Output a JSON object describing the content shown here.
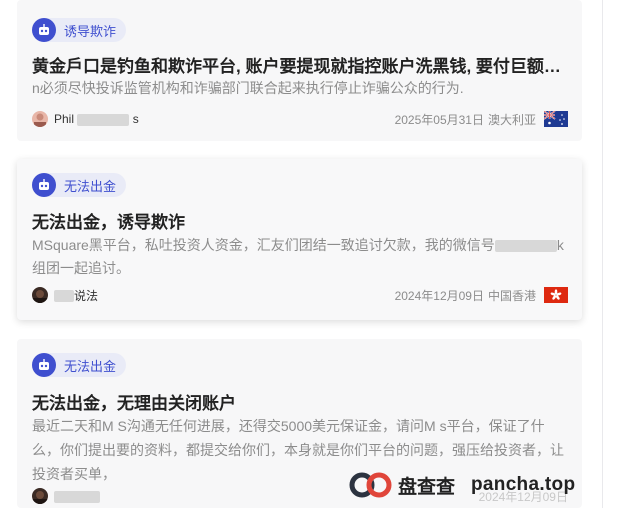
{
  "cards": [
    {
      "tag": "诱导欺诈",
      "title": "黄金戶口是钓鱼和欺诈平台, 账户要提现就指控账户洗黑钱, 要付巨额罰款.…",
      "desc": "n必须尽快投诉监管机构和诈骗部门联合起来执行停止诈骗公众的行为.",
      "user": "Phil",
      "user_tail": "s",
      "date": "2025年05月31日",
      "location": "澳大利亚",
      "flag": "australia-flag-icon"
    },
    {
      "tag": "无法出金",
      "title": "无法出金，诱导欺诈",
      "desc_a": "MSquare黑平台，私吐投资人资金，汇友们团结一致追讨欠款，我的微信号",
      "desc_b": "k",
      "desc_c": "组团一起追讨。",
      "user_tail": "说法",
      "date": "2024年12月09日",
      "location": "中国香港",
      "flag": "hongkong-flag-icon"
    },
    {
      "tag": "无法出金",
      "title": "无法出金，无理由关闭账户",
      "desc": "最近二天和M S沟通无任何进展，还得交5000美元保证金，请问M s平台，保证了什么，你们提出要的资料，都提交给你们，本身就是你们平台的问题，强压给投资者，让投资者买单，",
      "date": "2024年12月09日"
    }
  ],
  "watermark": {
    "brand": "盘查查",
    "domain": "pancha.top"
  }
}
